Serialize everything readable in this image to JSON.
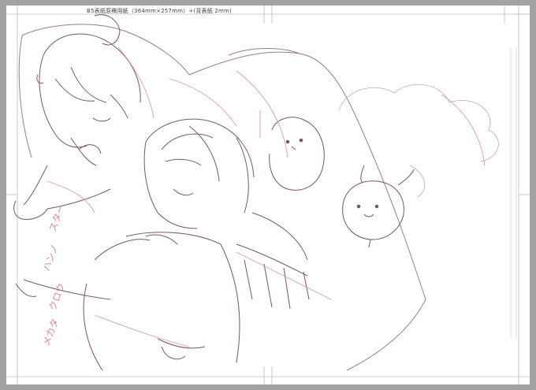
{
  "canvas": {
    "caption": "B5表紙原稿用紙（364mm×257mm）+(背表紙 2mm)",
    "paper_color": "#ffffff",
    "border_color": "#a3a3a3",
    "guide_color": "#bcbcbc",
    "line_color": "#8a5a66",
    "red_line_color": "#d98a96"
  },
  "artwork": {
    "subject": "line-art sketch of two sleeping girls with two small birds",
    "margin_marks": [
      "ス",
      "タ",
      "ー",
      "ハ",
      "ン",
      "ノ",
      "ク",
      "ロ",
      "ウ",
      "メ",
      "カ",
      "タ"
    ]
  }
}
